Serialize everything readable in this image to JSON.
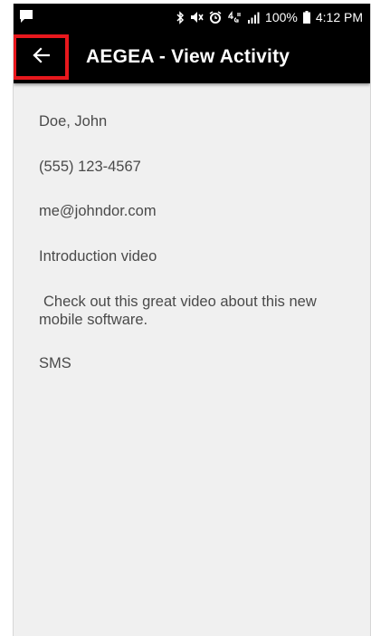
{
  "status_bar": {
    "battery": "100%",
    "time": "4:12 PM",
    "icons": [
      "message-icon",
      "bluetooth-icon",
      "mute-icon",
      "alarm-icon",
      "lte-icon",
      "signal-icon",
      "battery-icon"
    ]
  },
  "app_bar": {
    "back_icon": "arrow-left-icon",
    "title": "AEGEA - View Activity",
    "highlight_color": "#e8181d"
  },
  "activity": {
    "name": "Doe, John",
    "phone": "(555) 123-4567",
    "email": "me@johndor.com",
    "title": "Introduction video",
    "description": "Check out this great video about this new mobile software.",
    "type": "SMS"
  }
}
